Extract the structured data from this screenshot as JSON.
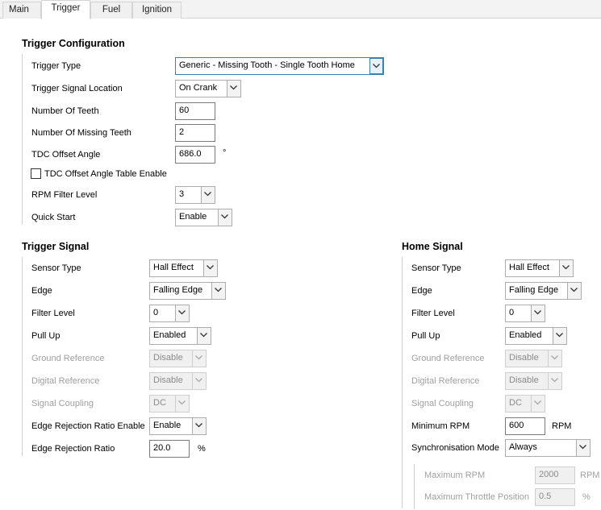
{
  "tabs": [
    "Main",
    "Trigger",
    "Fuel",
    "Ignition"
  ],
  "trigger_config": {
    "title": "Trigger Configuration",
    "trigger_type": {
      "label": "Trigger Type",
      "value": "Generic - Missing Tooth - Single Tooth Home"
    },
    "signal_location": {
      "label": "Trigger Signal Location",
      "value": "On Crank"
    },
    "num_teeth": {
      "label": "Number Of Teeth",
      "value": "60"
    },
    "num_missing": {
      "label": "Number Of Missing Teeth",
      "value": "2"
    },
    "tdc_offset": {
      "label": "TDC Offset Angle",
      "value": "686.0",
      "unit": "°"
    },
    "tdc_table": {
      "label": "TDC Offset Angle Table Enable",
      "checked": false
    },
    "rpm_filter": {
      "label": "RPM Filter Level",
      "value": "3"
    },
    "quick_start": {
      "label": "Quick Start",
      "value": "Enable"
    }
  },
  "trigger_signal": {
    "title": "Trigger Signal",
    "sensor_type": {
      "label": "Sensor Type",
      "value": "Hall Effect"
    },
    "edge": {
      "label": "Edge",
      "value": "Falling Edge"
    },
    "filter_level": {
      "label": "Filter Level",
      "value": "0"
    },
    "pull_up": {
      "label": "Pull Up",
      "value": "Enabled"
    },
    "ground_ref": {
      "label": "Ground Reference",
      "value": "Disable"
    },
    "digital_ref": {
      "label": "Digital Reference",
      "value": "Disable"
    },
    "coupling": {
      "label": "Signal Coupling",
      "value": "DC"
    },
    "edge_rej_enable": {
      "label": "Edge Rejection Ratio Enable",
      "value": "Enable"
    },
    "edge_rej_ratio": {
      "label": "Edge Rejection Ratio",
      "value": "20.0",
      "unit": "%"
    }
  },
  "home_signal": {
    "title": "Home Signal",
    "sensor_type": {
      "label": "Sensor Type",
      "value": "Hall Effect"
    },
    "edge": {
      "label": "Edge",
      "value": "Falling Edge"
    },
    "filter_level": {
      "label": "Filter Level",
      "value": "0"
    },
    "pull_up": {
      "label": "Pull Up",
      "value": "Enabled"
    },
    "ground_ref": {
      "label": "Ground Reference",
      "value": "Disable"
    },
    "digital_ref": {
      "label": "Digital Reference",
      "value": "Disable"
    },
    "coupling": {
      "label": "Signal Coupling",
      "value": "DC"
    },
    "min_rpm": {
      "label": "Minimum RPM",
      "value": "600",
      "unit": "RPM"
    },
    "sync_mode": {
      "label": "Synchronisation Mode",
      "value": "Always"
    },
    "max_rpm": {
      "label": "Maximum RPM",
      "value": "2000",
      "unit": "RPM"
    },
    "max_throttle": {
      "label": "Maximum Throttle Position",
      "value": "0.5",
      "unit": "%"
    }
  }
}
